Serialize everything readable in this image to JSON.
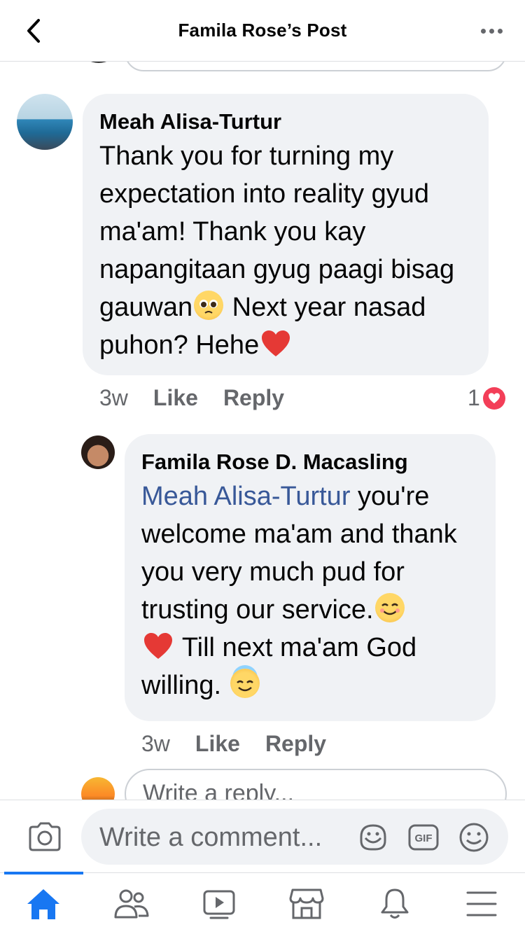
{
  "header": {
    "title": "Famila Rose’s Post"
  },
  "comments": [
    {
      "author": "Meah Alisa-Turtur",
      "text_before_emoji": "Thank you for turning my expectation into reality gyud ma'am! Thank you kay napangitaan gyug paagi bisag gauwan",
      "text_after_emoji": " Next year nasad puhon? Hehe",
      "time": "3w",
      "like_label": "Like",
      "reply_label": "Reply",
      "reaction_count": "1"
    }
  ],
  "replies": [
    {
      "author": "Famila Rose D. Macasling",
      "mention": "Meah Alisa-Turtur",
      "text_part1": " you're welcome ma'am and thank you very much pud for trusting our service.",
      "text_part2": " Till next ma'am God willing. ",
      "time": "3w",
      "like_label": "Like",
      "reply_label": "Reply"
    }
  ],
  "reply_input": {
    "placeholder": "Write a reply..."
  },
  "composer": {
    "placeholder": "Write a comment...",
    "icons": [
      "camera-icon",
      "sticker-icon",
      "gif-icon",
      "emoji-icon"
    ]
  },
  "tabbar": {
    "items": [
      "home",
      "friends",
      "watch",
      "marketplace",
      "notifications",
      "menu"
    ],
    "active": "home",
    "accent_color": "#1877f2"
  },
  "colors": {
    "bubble": "#f0f2f5",
    "mention": "#385898",
    "secondary_text": "#65676b",
    "reaction": "#f33e58"
  }
}
